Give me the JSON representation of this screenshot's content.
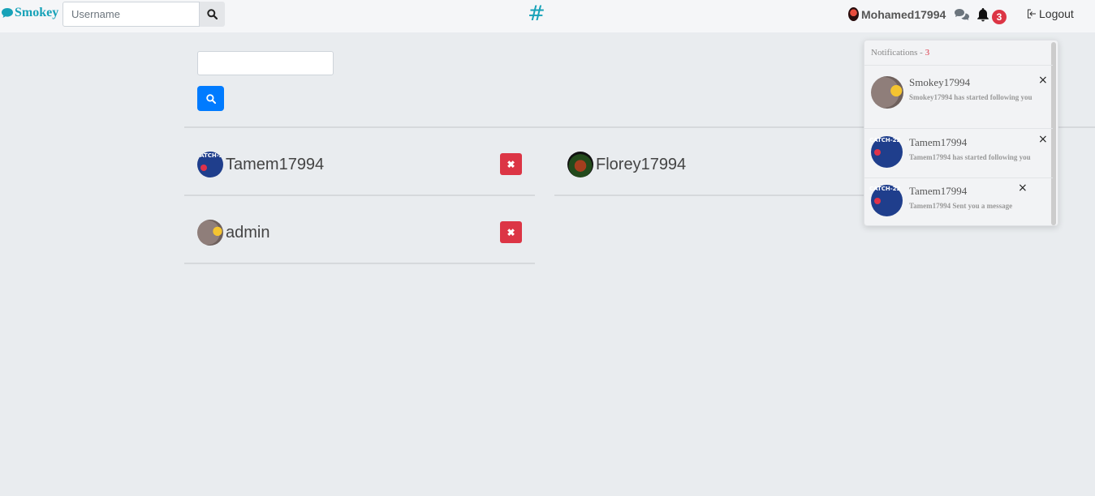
{
  "navbar": {
    "brand": "Smokey",
    "search_placeholder": "Username",
    "center_symbol": "#",
    "current_user": "Mohamed17994",
    "notification_count": "3",
    "logout_label": "Logout"
  },
  "main": {
    "filter_placeholder": "",
    "users": [
      {
        "name": "Tamem17994",
        "delete_label": "✖"
      },
      {
        "name": "Florey17994"
      },
      {
        "name": "admin",
        "delete_label": "✖"
      }
    ]
  },
  "notifications": {
    "title": "Notifications - ",
    "count": "3",
    "items": [
      {
        "name": "Smokey17994",
        "text": "Smokey17994 has started following you",
        "close": "×"
      },
      {
        "name": "Tamem17994",
        "text": "Tamem17994 has started following you",
        "close": "×"
      },
      {
        "name": "Tamem17994",
        "text": "Tamem17994 Sent you a message",
        "close": "×"
      }
    ]
  },
  "colors": {
    "brand": "#17a2b8",
    "primary": "#007bff",
    "danger": "#dc3545",
    "background": "#e9ecef"
  }
}
